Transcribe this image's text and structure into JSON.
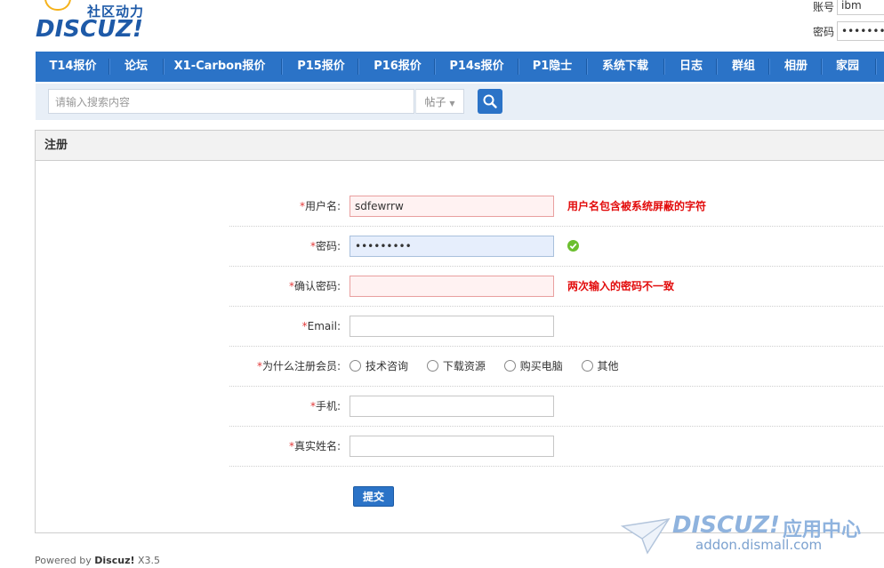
{
  "logo": {
    "slogan": "社区动力",
    "wordmark": "DISCUZ!"
  },
  "login": {
    "account_label": "账号",
    "account_value": "ibm",
    "password_label": "密码",
    "password_value": "••••••••••"
  },
  "nav": {
    "items": [
      "T14报价",
      "论坛",
      "X1-Carbon报价",
      "P15报价",
      "P16报价",
      "P14s报价",
      "P1隐士",
      "系统下载",
      "日志",
      "群组",
      "相册",
      "家园"
    ]
  },
  "search": {
    "placeholder": "请输入搜索内容",
    "type": "帖子"
  },
  "panel": {
    "title": "注册"
  },
  "form": {
    "required_mark": "*",
    "username": {
      "label": "用户名:",
      "value": "sdfewrrw",
      "error": "用户名包含被系统屏蔽的字符"
    },
    "password": {
      "label": "密码:",
      "value": "•••••••••"
    },
    "confirm": {
      "label": "确认密码:",
      "value": "",
      "error": "两次输入的密码不一致"
    },
    "email": {
      "label": "Email:",
      "value": ""
    },
    "reason": {
      "label": "为什么注册会员:",
      "options": [
        "技术咨询",
        "下载资源",
        "购买电脑",
        "其他"
      ]
    },
    "phone": {
      "label": "手机:",
      "value": ""
    },
    "realname": {
      "label": "真实姓名:",
      "value": ""
    },
    "submit_label": "提交"
  },
  "footer": {
    "powered_by": "Powered by",
    "brand": "Discuz!",
    "version": "X3.5"
  },
  "watermark": {
    "brand": "DISCUZ!",
    "app_center": "应用中心",
    "url": "addon.dismall.com"
  },
  "colors": {
    "nav_blue": "#2b73c7",
    "error_red": "#e20c0c",
    "ok_green": "#6cbf2f"
  }
}
